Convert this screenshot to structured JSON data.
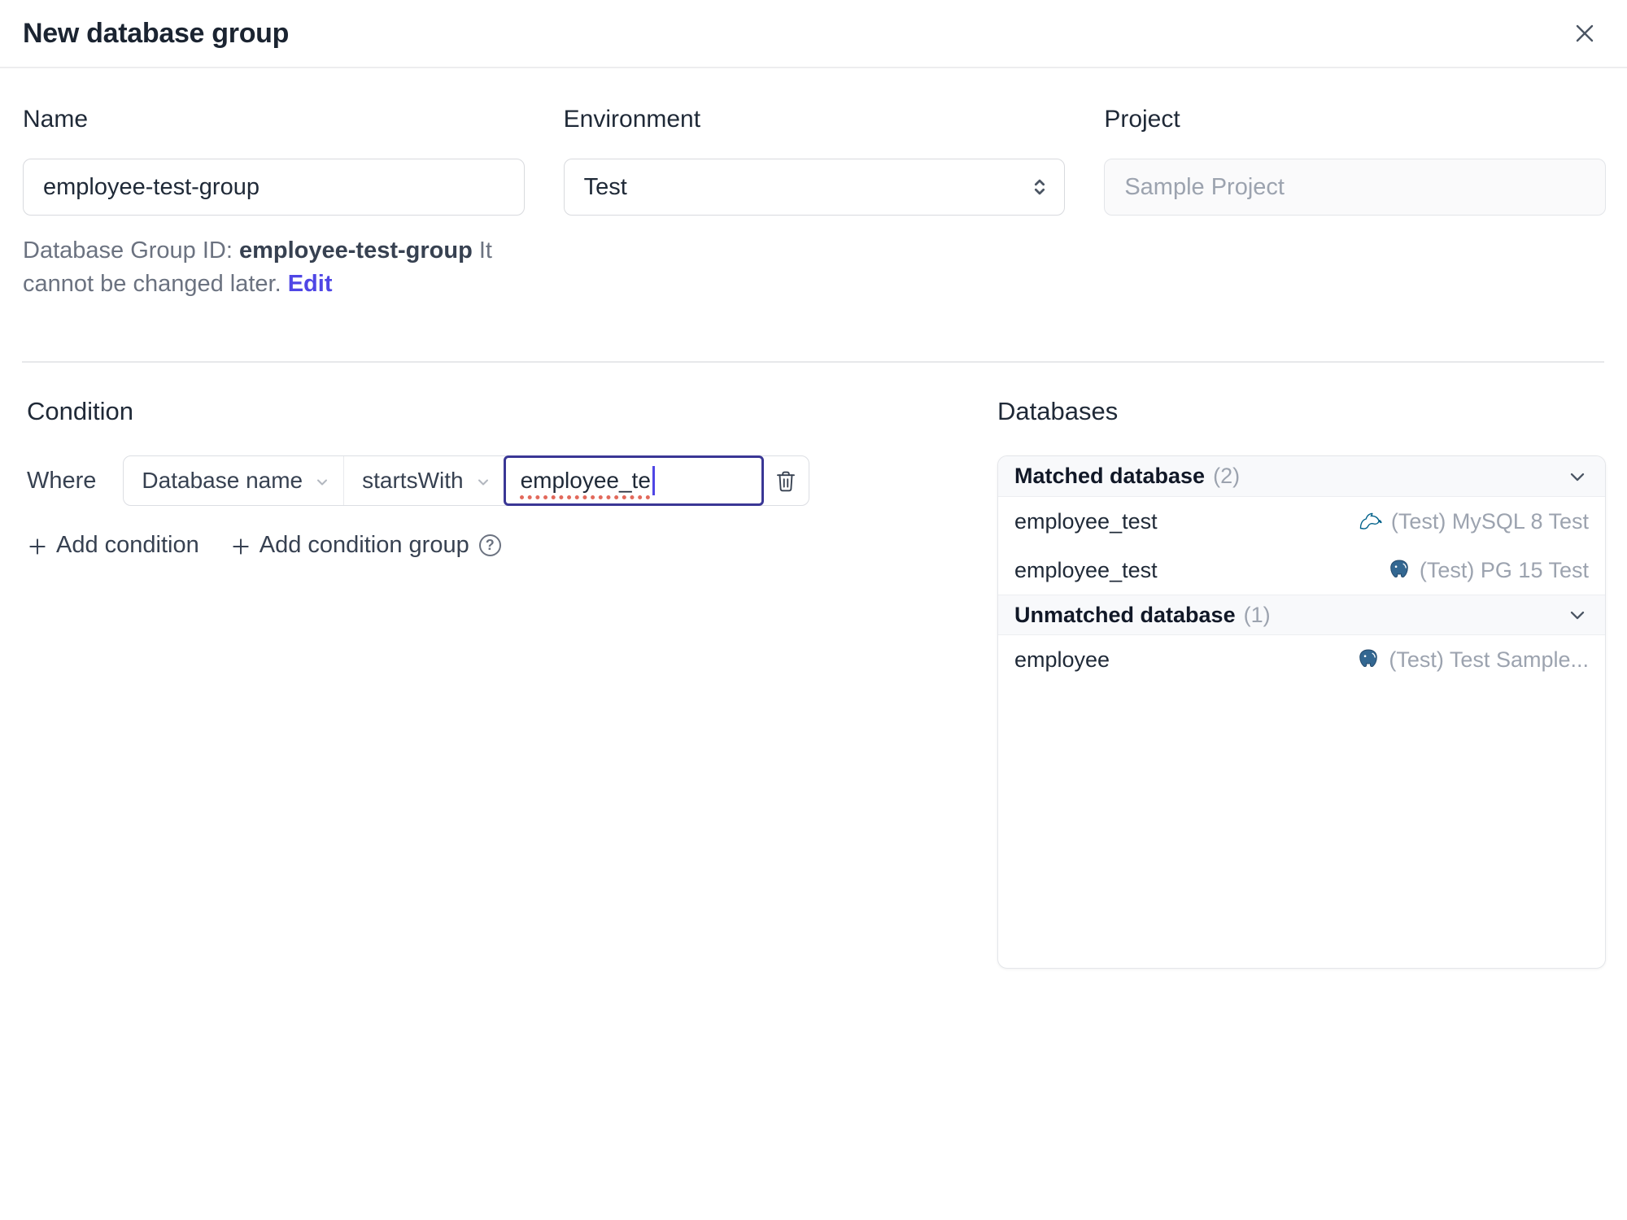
{
  "header": {
    "title": "New database group"
  },
  "form": {
    "name": {
      "label": "Name",
      "value": "employee-test-group"
    },
    "environment": {
      "label": "Environment",
      "value": "Test"
    },
    "project": {
      "label": "Project",
      "value": "Sample Project"
    },
    "group_id_note": {
      "prefix": "Database Group ID:",
      "id": "employee-test-group",
      "suffix": "It cannot be changed later.",
      "edit": "Edit"
    }
  },
  "condition": {
    "heading": "Condition",
    "where": "Where",
    "factor": "Database name",
    "operator": "startsWith",
    "value": "employee_te",
    "plus": "+",
    "add_condition": "Add condition",
    "add_condition_group": "Add condition group",
    "help_glyph": "?"
  },
  "databases": {
    "heading": "Databases",
    "matched": {
      "label": "Matched database",
      "count": "(2)"
    },
    "unmatched": {
      "label": "Unmatched database",
      "count": "(1)"
    },
    "matched_rows": [
      {
        "name": "employee_test",
        "engine": "mysql",
        "instance": "(Test) MySQL 8 Test"
      },
      {
        "name": "employee_test",
        "engine": "postgresql",
        "instance": "(Test) PG 15 Test"
      }
    ],
    "unmatched_rows": [
      {
        "name": "employee",
        "engine": "postgresql",
        "instance": "(Test) Test Sample..."
      }
    ]
  },
  "colors": {
    "accent": "#4f46e5",
    "focus_border": "#3a3795",
    "spellcheck_underline": "#e2695b",
    "mysql_icon": "#00618a",
    "postgresql_icon": "#336791"
  }
}
